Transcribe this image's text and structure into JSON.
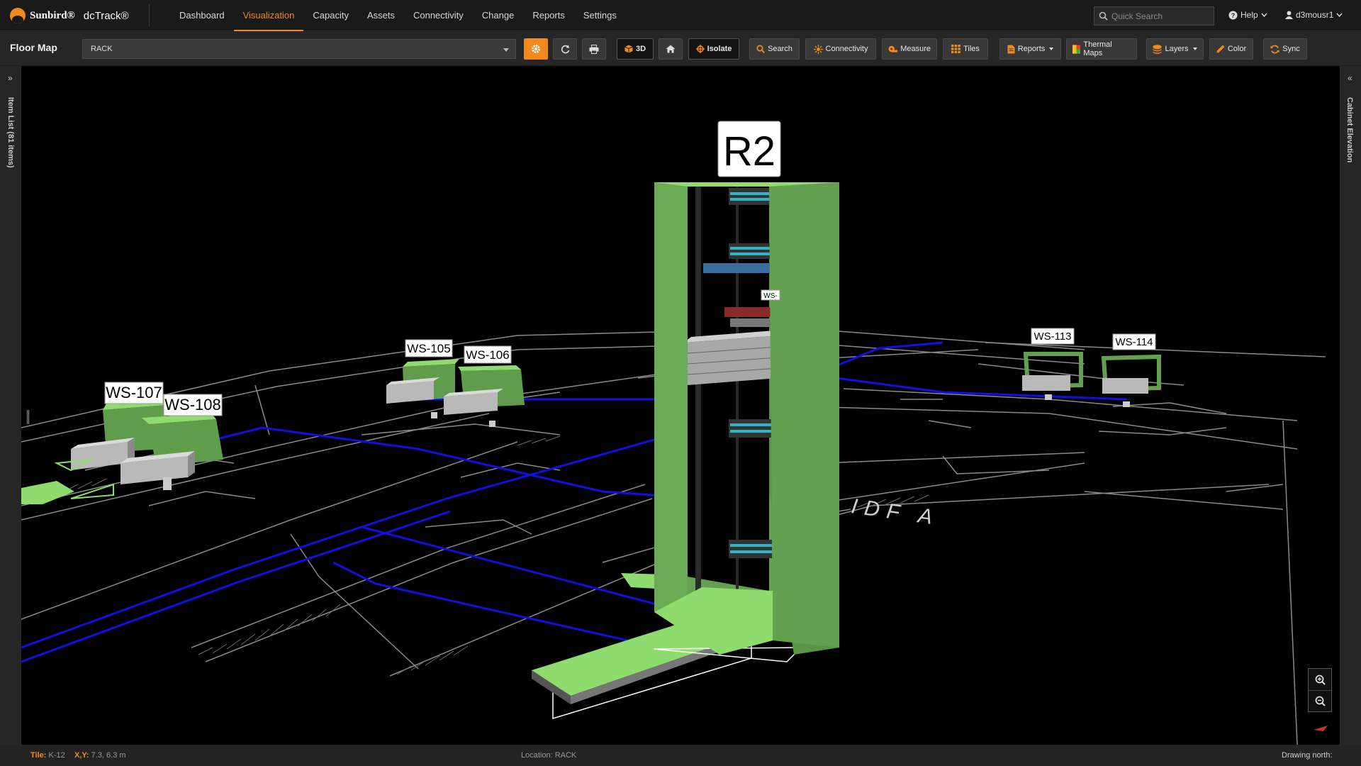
{
  "app": {
    "brand": "Sunbird®",
    "product": "dcTrack®"
  },
  "nav": {
    "items": [
      {
        "label": "Dashboard",
        "active": false
      },
      {
        "label": "Visualization",
        "active": true
      },
      {
        "label": "Capacity",
        "active": false
      },
      {
        "label": "Assets",
        "active": false
      },
      {
        "label": "Connectivity",
        "active": false
      },
      {
        "label": "Change",
        "active": false
      },
      {
        "label": "Reports",
        "active": false
      },
      {
        "label": "Settings",
        "active": false
      }
    ],
    "search_placeholder": "Quick Search",
    "help_label": "Help",
    "user_label": "d3mousr1"
  },
  "toolbar": {
    "title": "Floor Map",
    "selector_value": "RACK",
    "btn_3d": "3D",
    "btn_isolate": "Isolate",
    "btn_search": "Search",
    "btn_connectivity": "Connectivity",
    "btn_measure": "Measure",
    "btn_tiles": "Tiles",
    "btn_reports": "Reports",
    "btn_thermal": "Thermal Maps",
    "btn_layers": "Layers",
    "btn_color": "Color",
    "btn_sync": "Sync"
  },
  "panels": {
    "left_label": "Item List (81 items)",
    "right_label": "Cabinet Elevation"
  },
  "scene": {
    "main_rack_label": "R2",
    "small_label": "WS-",
    "workstations": [
      "WS-105",
      "WS-106",
      "WS-107",
      "WS-108",
      "WS-113",
      "WS-114"
    ],
    "floor_text": "IDF  A",
    "colors": {
      "cabinet": "#63a04f",
      "cabinet_light": "#8fdc6e",
      "cable": "#1010e0",
      "floor_line": "#8a8a8a",
      "accent": "#f08a1c"
    }
  },
  "status": {
    "tile_key": "Tile:",
    "tile_val": "K-12",
    "xy_key": "X,Y:",
    "xy_val": "7.3, 6.3 m",
    "location_label": "Location: RACK",
    "drawing_north": "Drawing north:"
  }
}
